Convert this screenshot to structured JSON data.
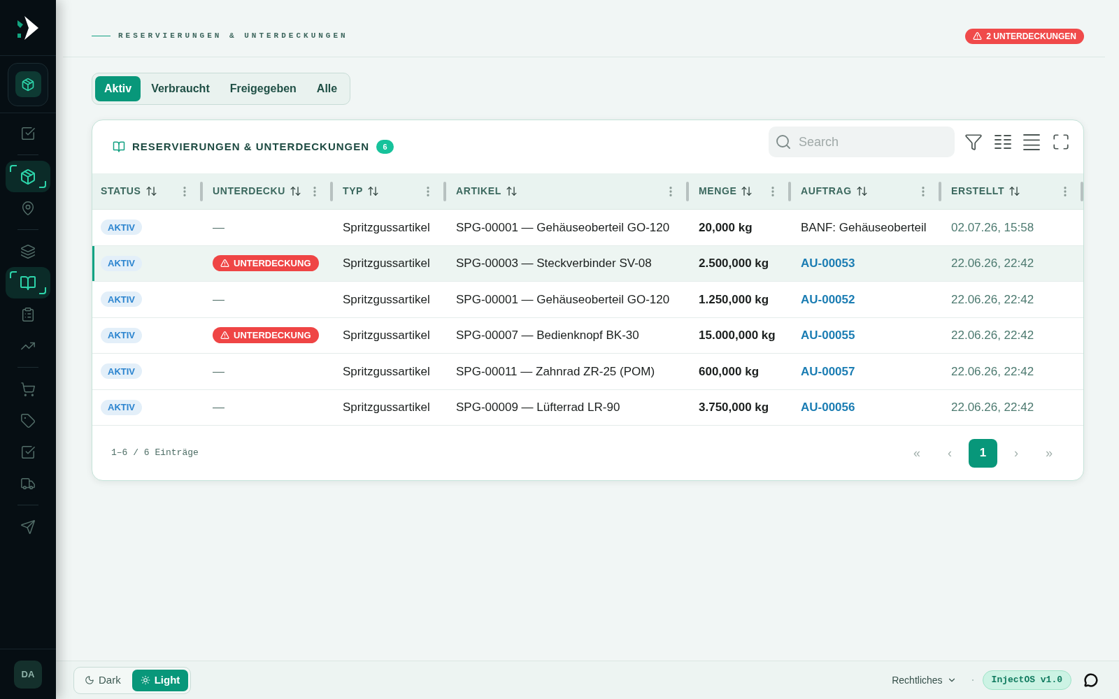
{
  "sidebar": {
    "groups": [
      {
        "items": [
          {
            "selected": false
          }
        ]
      },
      {
        "items": [
          {
            "selected": true
          },
          {
            "selected": false
          }
        ]
      },
      {
        "items": [
          {
            "selected": false
          },
          {
            "selected": true
          },
          {
            "selected": false
          },
          {
            "selected": false
          }
        ]
      },
      {
        "items": [
          {
            "selected": false
          },
          {
            "selected": false
          },
          {
            "selected": false
          },
          {
            "selected": false
          }
        ]
      },
      {
        "items": [
          {
            "selected": false
          }
        ]
      }
    ],
    "avatar": "DA"
  },
  "header": {
    "title": "RESERVIERUNGEN & UNTERDECKUNGEN",
    "alert_badge": "2 UNTERDECKUNGEN"
  },
  "tabs": [
    {
      "label": "Aktiv",
      "selected": true
    },
    {
      "label": "Verbraucht",
      "selected": false
    },
    {
      "label": "Freigegeben",
      "selected": false
    },
    {
      "label": "Alle",
      "selected": false
    }
  ],
  "table_card": {
    "title": "RESERVIERUNGEN & UNTERDECKUNGEN",
    "count": "6",
    "search": {
      "placeholder": "Search"
    },
    "columns": [
      "STATUS",
      "UNTERDECKU",
      "TYP",
      "ARTIKEL",
      "MENGE",
      "AUFTRAG",
      "ERSTELLT"
    ],
    "rows": [
      {
        "selected": false,
        "status": "AKTIV",
        "shortage": {
          "kind": "none",
          "text": "—"
        },
        "type": "Spritzgussartikel",
        "article": "SPG-00001 — Gehäuseoberteil GO-120",
        "quantity": "20,000 kg",
        "order": {
          "kind": "text",
          "text": "BANF: Gehäuseoberteil"
        },
        "created": "02.07.26, 15:58"
      },
      {
        "selected": true,
        "status": "AKTIV",
        "shortage": {
          "kind": "badge",
          "text": "UNTERDECKUNG"
        },
        "type": "Spritzgussartikel",
        "article": "SPG-00003 — Steckverbinder SV-08",
        "quantity": "2.500,000 kg",
        "order": {
          "kind": "link",
          "text": "AU-00053"
        },
        "created": "22.06.26, 22:42"
      },
      {
        "selected": false,
        "status": "AKTIV",
        "shortage": {
          "kind": "none",
          "text": "—"
        },
        "type": "Spritzgussartikel",
        "article": "SPG-00001 — Gehäuseoberteil GO-120",
        "quantity": "1.250,000 kg",
        "order": {
          "kind": "link",
          "text": "AU-00052"
        },
        "created": "22.06.26, 22:42"
      },
      {
        "selected": false,
        "status": "AKTIV",
        "shortage": {
          "kind": "badge",
          "text": "UNTERDECKUNG"
        },
        "type": "Spritzgussartikel",
        "article": "SPG-00007 — Bedienknopf BK-30",
        "quantity": "15.000,000 kg",
        "order": {
          "kind": "link",
          "text": "AU-00055"
        },
        "created": "22.06.26, 22:42"
      },
      {
        "selected": false,
        "status": "AKTIV",
        "shortage": {
          "kind": "none",
          "text": "—"
        },
        "type": "Spritzgussartikel",
        "article": "SPG-00011 — Zahnrad ZR-25 (POM)",
        "quantity": "600,000 kg",
        "order": {
          "kind": "link",
          "text": "AU-00057"
        },
        "created": "22.06.26, 22:42"
      },
      {
        "selected": false,
        "status": "AKTIV",
        "shortage": {
          "kind": "none",
          "text": "—"
        },
        "type": "Spritzgussartikel",
        "article": "SPG-00009 — Lüfterrad LR-90",
        "quantity": "3.750,000 kg",
        "order": {
          "kind": "link",
          "text": "AU-00056"
        },
        "created": "22.06.26, 22:42"
      }
    ],
    "footer": {
      "range": "1–6 / 6 Einträge",
      "pagination": {
        "first": "«",
        "prev": "‹",
        "pages": [
          {
            "label": "1",
            "selected": true
          }
        ],
        "next": "›",
        "last": "»"
      }
    }
  },
  "bottom_bar": {
    "theme_toggle": [
      {
        "label": "Dark",
        "selected": false
      },
      {
        "label": "Light",
        "selected": true
      }
    ],
    "legal_menu": "Rechtliches",
    "version": "InjectOS v1.0"
  }
}
